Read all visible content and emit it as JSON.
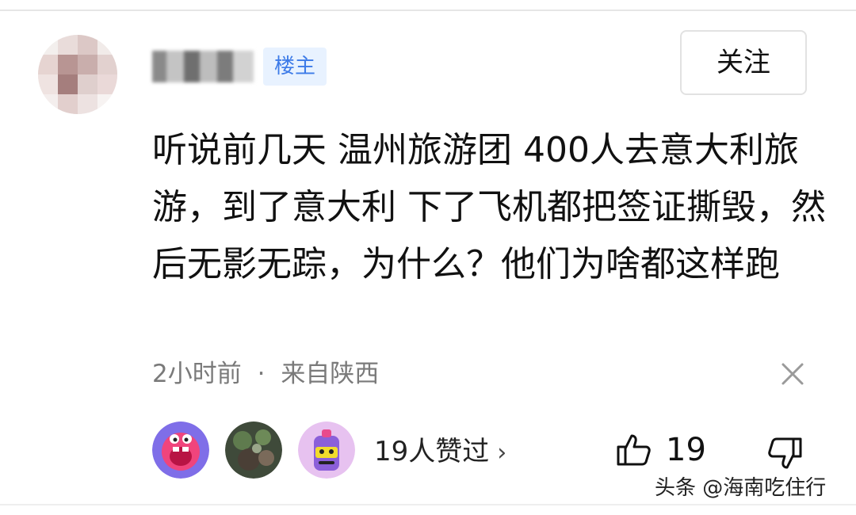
{
  "header": {
    "badge_label": "楼主",
    "follow_label": "关注"
  },
  "comment": {
    "text": "听说前几天 温州旅游团 400人去意大利旅游，到了意大利 下了飞机都把签证撕毁，然后无影无踪，为什么？他们为啥都这样跑"
  },
  "meta": {
    "time": "2小时前",
    "separator": "·",
    "location": "来自陕西"
  },
  "footer": {
    "liked_by": "19人赞过",
    "liked_chevron": "›",
    "like_count": "19"
  },
  "watermark": {
    "text": "头条 @海南吃住行"
  },
  "icons": {
    "close": "close-icon",
    "thumbs_up": "thumbs-up-icon",
    "thumbs_down": "thumbs-down-icon",
    "chevron": "chevron-right-icon"
  },
  "colors": {
    "badge_text": "#3d7be8",
    "badge_bg": "#e8f2ff",
    "meta_text": "#7a7a7a"
  }
}
